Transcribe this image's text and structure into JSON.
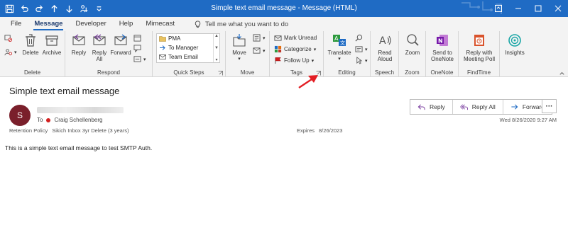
{
  "window": {
    "title": "Simple text email message  -  Message (HTML)",
    "accent": "#1f6bc4"
  },
  "tabs": [
    {
      "label": "File"
    },
    {
      "label": "Message"
    },
    {
      "label": "Developer"
    },
    {
      "label": "Help"
    },
    {
      "label": "Mimecast"
    }
  ],
  "tell_me": {
    "placeholder": "Tell me what you want to do"
  },
  "ribbon": {
    "delete_group": {
      "label": "Delete",
      "delete": "Delete",
      "archive": "Archive"
    },
    "respond_group": {
      "label": "Respond",
      "reply": "Reply",
      "reply_all_1": "Reply",
      "reply_all_2": "All",
      "forward": "Forward"
    },
    "quick_steps": {
      "label": "Quick Steps",
      "items": [
        "PMA",
        "To Manager",
        "Team Email"
      ]
    },
    "move_group": {
      "label": "Move",
      "move": "Move"
    },
    "tags_group": {
      "label": "Tags",
      "mark_unread": "Mark Unread",
      "categorize": "Categorize",
      "follow_up": "Follow Up"
    },
    "editing_group": {
      "label": "Editing",
      "translate": "Translate"
    },
    "speech_group": {
      "label": "Speech",
      "read_aloud_1": "Read",
      "read_aloud_2": "Aloud"
    },
    "zoom_group": {
      "label": "Zoom",
      "zoom": "Zoom"
    },
    "onenote_group": {
      "label": "OneNote",
      "send_1": "Send to",
      "send_2": "OneNote"
    },
    "findtime_group": {
      "label": "FindTime",
      "reply_meeting_1": "Reply with",
      "reply_meeting_2": "Meeting Poll"
    },
    "insights": {
      "label": "Insights"
    }
  },
  "message": {
    "subject": "Simple text email message",
    "avatar_initial": "S",
    "to_label": "To",
    "recipient": "Craig Schellenberg",
    "retention_label": "Retention Policy",
    "retention_value": "Sikich Inbox 3yr Delete (3 years)",
    "expires_label": "Expires",
    "expires_value": "8/26/2023",
    "date": "Wed 8/26/2020 9:27 AM",
    "body": "This is a simple text email message to test SMTP Auth.",
    "more": "···"
  },
  "actions": {
    "reply": "Reply",
    "reply_all": "Reply All",
    "forward": "Forward"
  }
}
